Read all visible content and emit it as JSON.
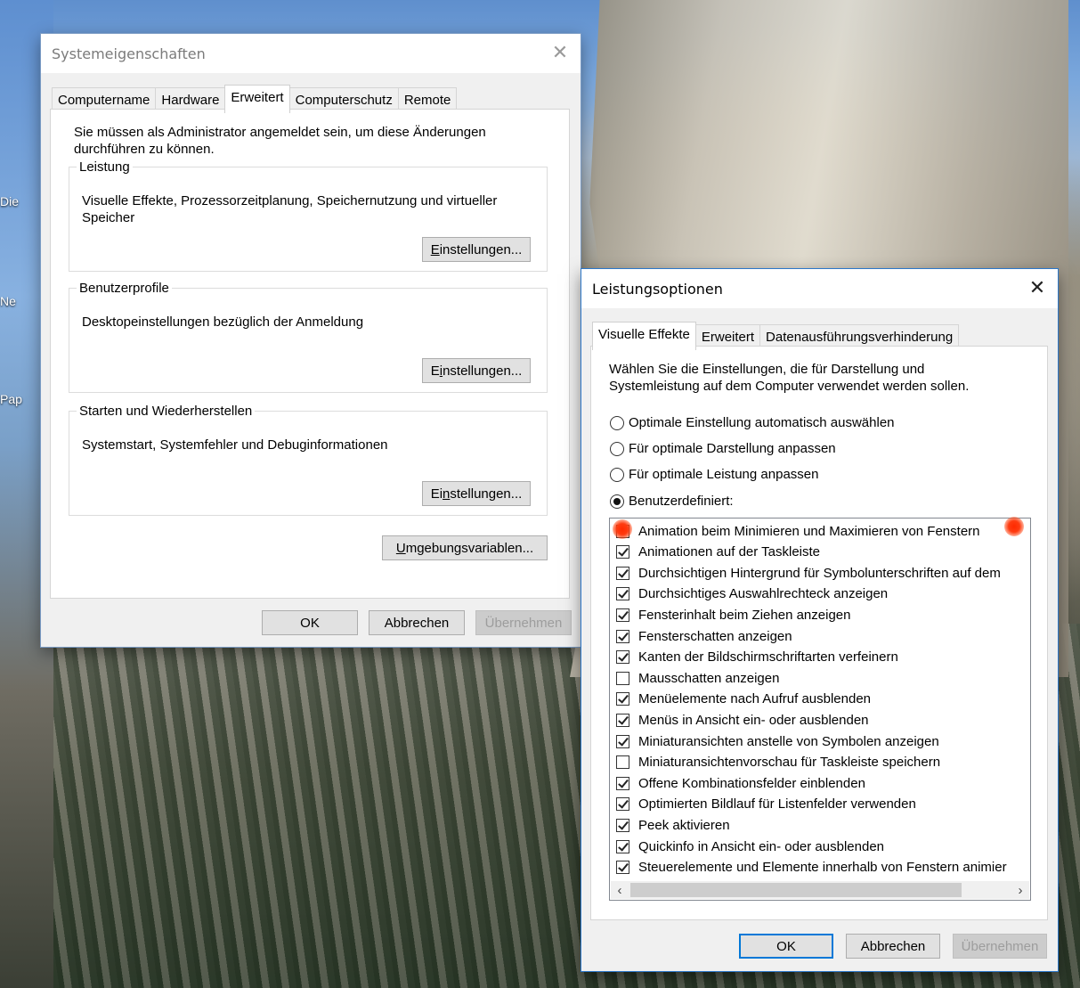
{
  "desktop": {
    "icon_labels": [
      "Die",
      "Ne",
      "Pap"
    ]
  },
  "system_properties": {
    "title": "Systemeigenschaften",
    "tabs": [
      {
        "label": "Computername",
        "active": false
      },
      {
        "label": "Hardware",
        "active": false
      },
      {
        "label": "Erweitert",
        "active": true
      },
      {
        "label": "Computerschutz",
        "active": false
      },
      {
        "label": "Remote",
        "active": false
      }
    ],
    "admin_notice": "Sie müssen als Administrator angemeldet sein, um diese Änderungen durchführen zu können.",
    "groups": [
      {
        "legend": "Leistung",
        "description": "Visuelle Effekte, Prozessorzeitplanung, Speichernutzung und virtueller Speicher",
        "button": "Einstellungen...",
        "accel": "E"
      },
      {
        "legend": "Benutzerprofile",
        "description": "Desktopeinstellungen bezüglich der Anmeldung",
        "button": "Einstellungen...",
        "accel": "i"
      },
      {
        "legend": "Starten und Wiederherstellen",
        "description": "Systemstart, Systemfehler und Debuginformationen",
        "button": "Einstellungen...",
        "accel": "n"
      }
    ],
    "env_button": "Umgebungsvariablen...",
    "footer": {
      "ok": "OK",
      "cancel": "Abbrechen",
      "apply": "Übernehmen"
    }
  },
  "performance_options": {
    "title": "Leistungsoptionen",
    "tabs": [
      {
        "label": "Visuelle Effekte",
        "active": true
      },
      {
        "label": "Erweitert",
        "active": false
      },
      {
        "label": "Datenausführungsverhinderung",
        "active": false
      }
    ],
    "intro": "Wählen Sie die Einstellungen, die für Darstellung und Systemleistung auf dem Computer verwendet werden sollen.",
    "radios": [
      {
        "label": "Optimale Einstellung automatisch auswählen",
        "checked": false
      },
      {
        "label": "Für optimale Darstellung anpassen",
        "checked": false
      },
      {
        "label": "Für optimale Leistung anpassen",
        "checked": false
      },
      {
        "label": "Benutzerdefiniert:",
        "checked": true
      }
    ],
    "effects": [
      {
        "label": "Animation beim Minimieren und Maximieren von Fenstern",
        "checked": false,
        "highlighted": true
      },
      {
        "label": "Animationen auf der Taskleiste",
        "checked": true
      },
      {
        "label": "Durchsichtigen Hintergrund für Symbolunterschriften auf dem",
        "checked": true
      },
      {
        "label": "Durchsichtiges Auswahlrechteck anzeigen",
        "checked": true
      },
      {
        "label": "Fensterinhalt beim Ziehen anzeigen",
        "checked": true
      },
      {
        "label": "Fensterschatten anzeigen",
        "checked": true
      },
      {
        "label": "Kanten der Bildschirmschriftarten verfeinern",
        "checked": true
      },
      {
        "label": "Mausschatten anzeigen",
        "checked": false
      },
      {
        "label": "Menüelemente nach Aufruf ausblenden",
        "checked": true
      },
      {
        "label": "Menüs in Ansicht ein- oder ausblenden",
        "checked": true
      },
      {
        "label": "Miniaturansichten anstelle von Symbolen anzeigen",
        "checked": true
      },
      {
        "label": "Miniaturansichtenvorschau für Taskleiste speichern",
        "checked": false
      },
      {
        "label": "Offene Kombinationsfelder einblenden",
        "checked": true
      },
      {
        "label": "Optimierten Bildlauf für Listenfelder verwenden",
        "checked": true
      },
      {
        "label": "Peek aktivieren",
        "checked": true
      },
      {
        "label": "Quickinfo in Ansicht ein- oder ausblenden",
        "checked": true
      },
      {
        "label": "Steuerelemente und Elemente innerhalb von Fenstern animier",
        "checked": true
      }
    ],
    "footer": {
      "ok": "OK",
      "cancel": "Abbrechen",
      "apply": "Übernehmen"
    },
    "highlight_color": "#ff2a00"
  }
}
